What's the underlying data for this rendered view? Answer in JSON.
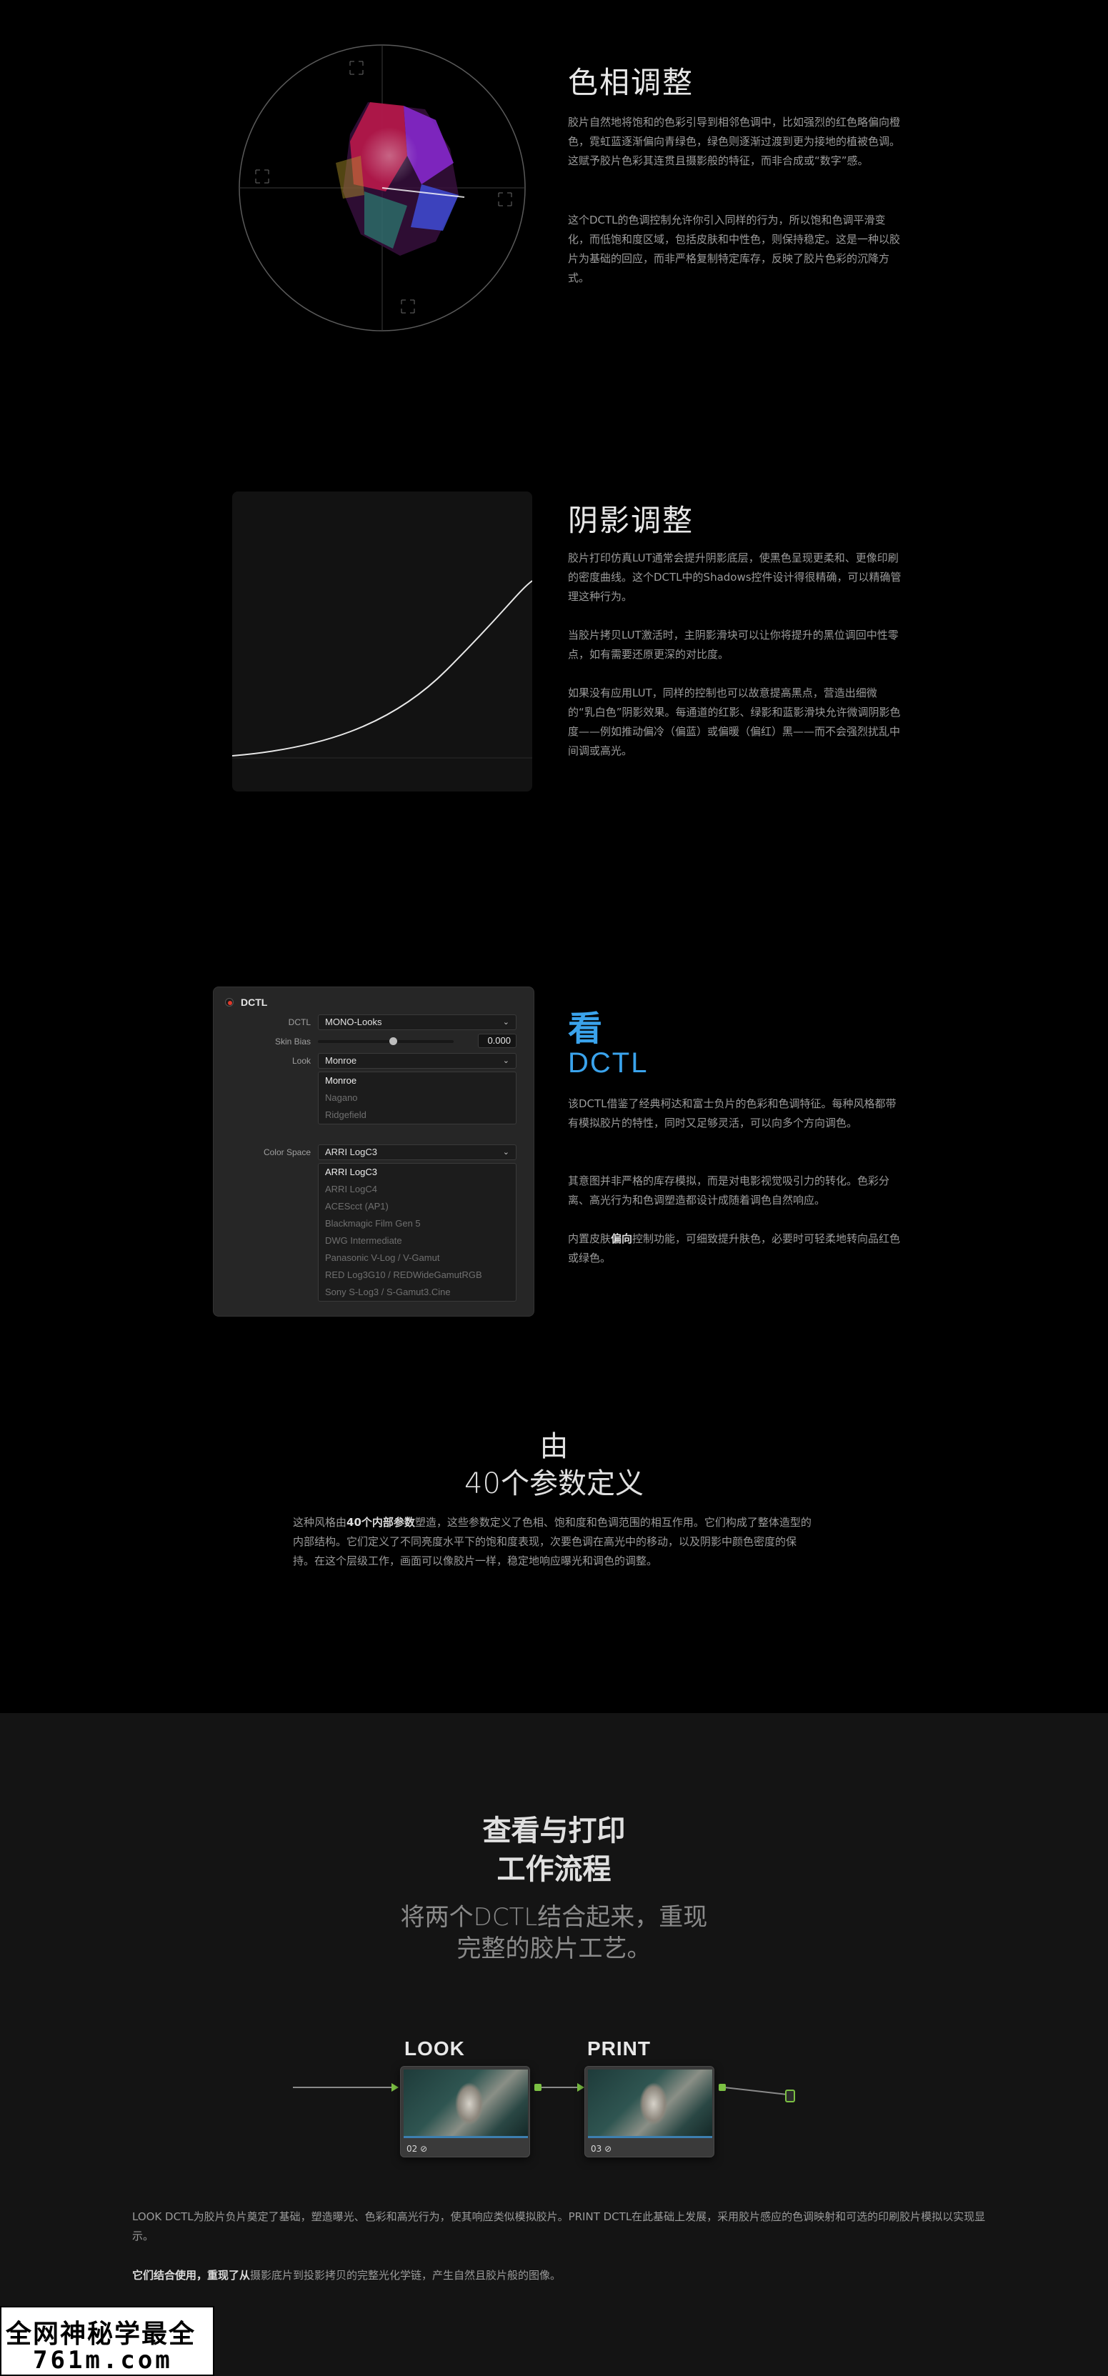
{
  "hue": {
    "title": "色相调整",
    "p1": "胶片自然地将饱和的色彩引导到相邻色调中，比如强烈的红色略偏向橙色，霓虹蓝逐渐偏向青绿色，绿色则逐渐过渡到更为接地的植被色调。这赋予胶片色彩其连贯且摄影般的特征，而非合成或“数字”感。",
    "p2": "这个DCTL的色调控制允许你引入同样的行为，所以饱和色调平滑变化，而低饱和度区域，包括皮肤和中性色，则保持稳定。这是一种以胶片为基础的回应，而非严格复制特定库存，反映了胶片色彩的沉降方式。"
  },
  "shadows": {
    "title": "阴影调整",
    "p1": "胶片打印仿真LUT通常会提升阴影底层，使黑色呈现更柔和、更像印刷的密度曲线。这个DCTL中的Shadows控件设计得很精确，可以精确管理这种行为。",
    "p2": "当胶片拷贝LUT激活时，主阴影滑块可以让你将提升的黑位调回中性零点，如有需要还原更深的对比度。",
    "p3": "如果没有应用LUT，同样的控制也可以故意提高黑点，营造出细微的“乳白色”阴影效果。每通道的红影、绿影和蓝影滑块允许微调阴影色度——例如推动偏冷（偏蓝）或偏暖（偏红）黑——而不会强烈扰乱中间调或高光。"
  },
  "dctl_panel": {
    "title": "DCTL",
    "dctl_label": "DCTL",
    "dctl_value": "MONO-Looks",
    "skin_label": "Skin Bias",
    "skin_value": "0.000",
    "skin_fraction": 0.55,
    "look_label": "Look",
    "look_value": "Monroe",
    "look_options": [
      "Monroe",
      "Nagano",
      "Ridgefield"
    ],
    "cs_label": "Color Space",
    "cs_value": "ARRI LogC3",
    "cs_options": [
      "ARRI LogC3",
      "ARRI LogC4",
      "ACEScct (AP1)",
      "Blackmagic Film Gen 5",
      "DWG Intermediate",
      "Panasonic V-Log / V-Gamut",
      "RED Log3G10 / REDWideGamutRGB",
      "Sony S-Log3 / S-Gamut3.Cine"
    ]
  },
  "look": {
    "title1": "看",
    "title2": "DCTL",
    "p1": "该DCTL借鉴了经典柯达和富士负片的色彩和色调特征。每种风格都带有模拟胶片的特性，同时又足够灵活，可以向多个方向调色。",
    "p2": "其意图并非严格的库存模拟，而是对电影视觉吸引力的转化。色彩分离、高光行为和色调塑造都设计成随着调色自然响应。",
    "p3a": "内置皮肤",
    "p3b": "偏向",
    "p3c": "控制功能，可细致提升肤色，必要时可轻柔地转向品红色或绿色。"
  },
  "params": {
    "line1": "由",
    "line2": "40个参数定义",
    "pa": "这种风格由",
    "pb": "40个内部参数",
    "pc": "塑造，这些参数定义了色相、饱和度和色调范围的相互作用。它们构成了整体造型的内部结构。它们定义了不同亮度水平下的饱和度表现，次要色调在高光中的移动，以及阴影中颜色密度的保持。在这个层级工作，画面可以像胶片一样，稳定地响应曝光和调色的调整。"
  },
  "workflow": {
    "title1": "查看与打印",
    "title2": "工作流程",
    "sub1": "将两个DCTL结合起来，重现",
    "sub2": "完整的胶片工艺。",
    "node1_title": "LOOK",
    "node1_id": "02",
    "node2_title": "PRINT",
    "node2_id": "03",
    "p1": "LOOK DCTL为胶片负片奠定了基础，塑造曝光、色彩和高光行为，使其响应类似模拟胶片。PRINT DCTL在此基础上发展，采用胶片感应的色调映射和可选的印刷胶片模拟以实现显示。",
    "p2a": "它们结合使用，重现了从",
    "p2b": "摄影底片到投影拷贝的完整光化学链，产生自然且胶片般的图像。"
  },
  "watermark": {
    "line1": "全网神秘学最全",
    "line2": "761m.com"
  }
}
